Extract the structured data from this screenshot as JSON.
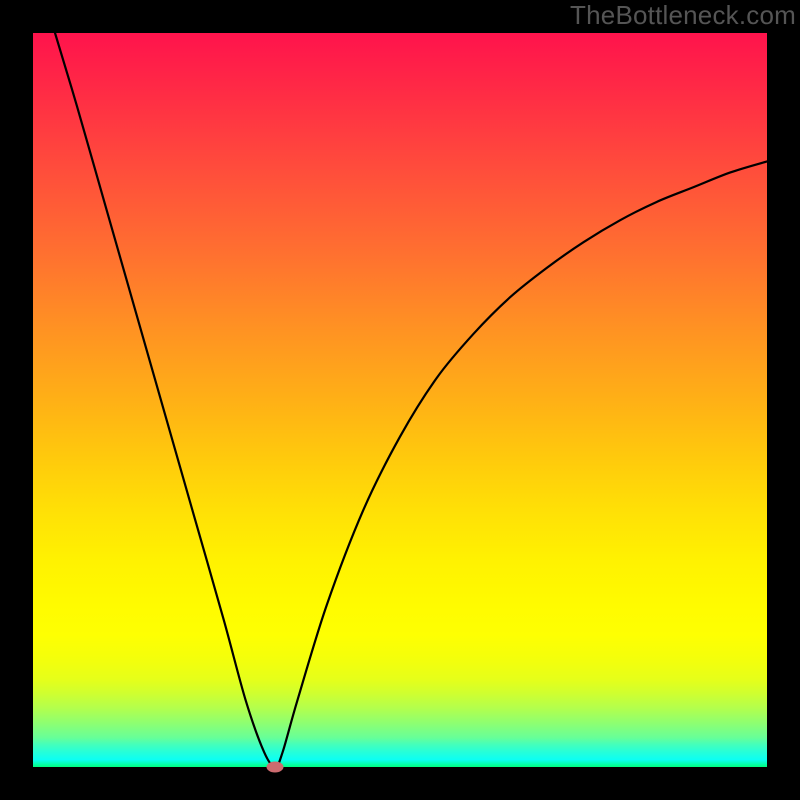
{
  "watermark": "TheBottleneck.com",
  "chart_data": {
    "type": "line",
    "title": "",
    "xlabel": "",
    "ylabel": "",
    "xlim": [
      0,
      100
    ],
    "ylim": [
      0,
      100
    ],
    "gradient_meaning": "percentage bottleneck (red=high, green=low)",
    "series": [
      {
        "name": "bottleneck-curve",
        "x": [
          3,
          6,
          10,
          14,
          18,
          22,
          26,
          29,
          31.5,
          33,
          34,
          36,
          40,
          45,
          50,
          55,
          60,
          65,
          70,
          75,
          80,
          85,
          90,
          95,
          100
        ],
        "y": [
          100,
          90,
          76,
          62,
          48,
          34,
          20,
          9,
          2,
          0,
          2,
          9,
          22,
          35,
          45,
          53,
          59,
          64,
          68,
          71.5,
          74.5,
          77,
          79,
          81,
          82.5
        ]
      }
    ],
    "marker": {
      "x": 33,
      "y": 0,
      "color": "#cc6b6f"
    }
  }
}
